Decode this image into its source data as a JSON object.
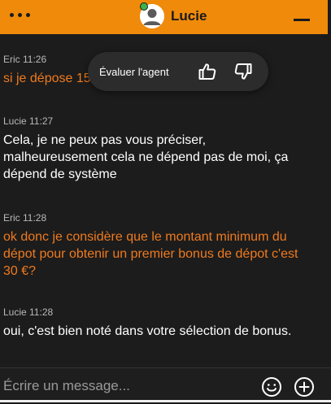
{
  "header": {
    "agent_name": "Lucie",
    "menu_icon": "more-dots-icon",
    "minimize_icon": "minimize-icon",
    "accent_color": "#ef8a0b"
  },
  "messages": [
    {
      "sender": "Eric",
      "time": "11:26",
      "meta": "Eric 11:26",
      "text": "si je dépose 15 €",
      "role": "user"
    },
    {
      "sender": "Lucie",
      "time": "11:27",
      "meta": "Lucie 11:27",
      "text": "Cela, je ne peux pas vous préciser, malheureusement cela ne dépend pas de moi, ça dépend de système",
      "role": "agent"
    },
    {
      "sender": "Eric",
      "time": "11:28",
      "meta": "Eric 11:28",
      "text": "ok donc je considère que le montant minimum du dépot pour obtenir un premier bonus de dépot c'est 30 €?",
      "role": "user"
    },
    {
      "sender": "Lucie",
      "time": "11:28",
      "meta": "Lucie 11:28",
      "text": "oui, c'est bien noté dans votre sélection de bonus.",
      "role": "agent"
    }
  ],
  "rating": {
    "label": "Évaluer l'agent",
    "thumbs_up_icon": "thumbs-up-icon",
    "thumbs_down_icon": "thumbs-down-icon"
  },
  "composer": {
    "placeholder": "Écrire un message...",
    "emoji_icon": "emoji-icon",
    "attach_icon": "add-circle-icon"
  }
}
